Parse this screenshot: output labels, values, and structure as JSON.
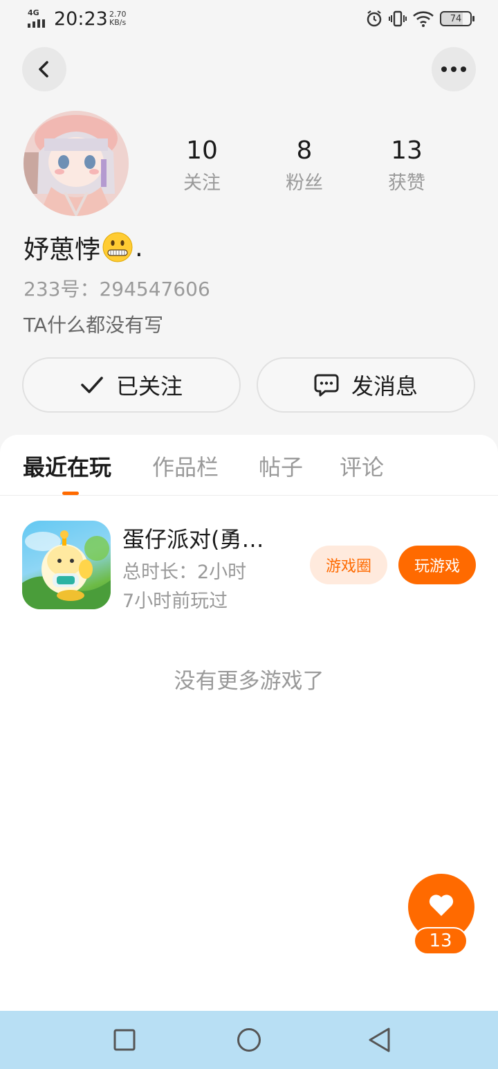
{
  "status_bar": {
    "network": "4G",
    "time": "20:23",
    "speed_value": "2.70",
    "speed_unit": "KB/s",
    "battery": "74"
  },
  "header": {
    "back_icon": "chevron-left-icon",
    "more_icon": "more-horizontal-icon"
  },
  "profile": {
    "stats": [
      {
        "value": "10",
        "label": "关注"
      },
      {
        "value": "8",
        "label": "粉丝"
      },
      {
        "value": "13",
        "label": "获赞"
      }
    ],
    "nickname": "妤葸悖",
    "nickname_suffix": ".",
    "uid": "233号：294547606",
    "bio": "TA什么都没有写"
  },
  "actions": {
    "follow_label": "已关注",
    "message_label": "发消息"
  },
  "tabs": [
    {
      "label": "最近在玩"
    },
    {
      "label": "作品栏"
    },
    {
      "label": "帖子"
    },
    {
      "label": "评论"
    }
  ],
  "games": [
    {
      "title": "蛋仔派对(勇…",
      "duration": "总时长：2小时",
      "last_played": "7小时前玩过",
      "circle_label": "游戏圈",
      "play_label": "玩游戏"
    }
  ],
  "empty_text": "没有更多游戏了",
  "like": {
    "count": "13"
  },
  "colors": {
    "accent": "#ff6a00",
    "accent_light": "#ffeadd",
    "nav_bg": "#b8dff4"
  }
}
